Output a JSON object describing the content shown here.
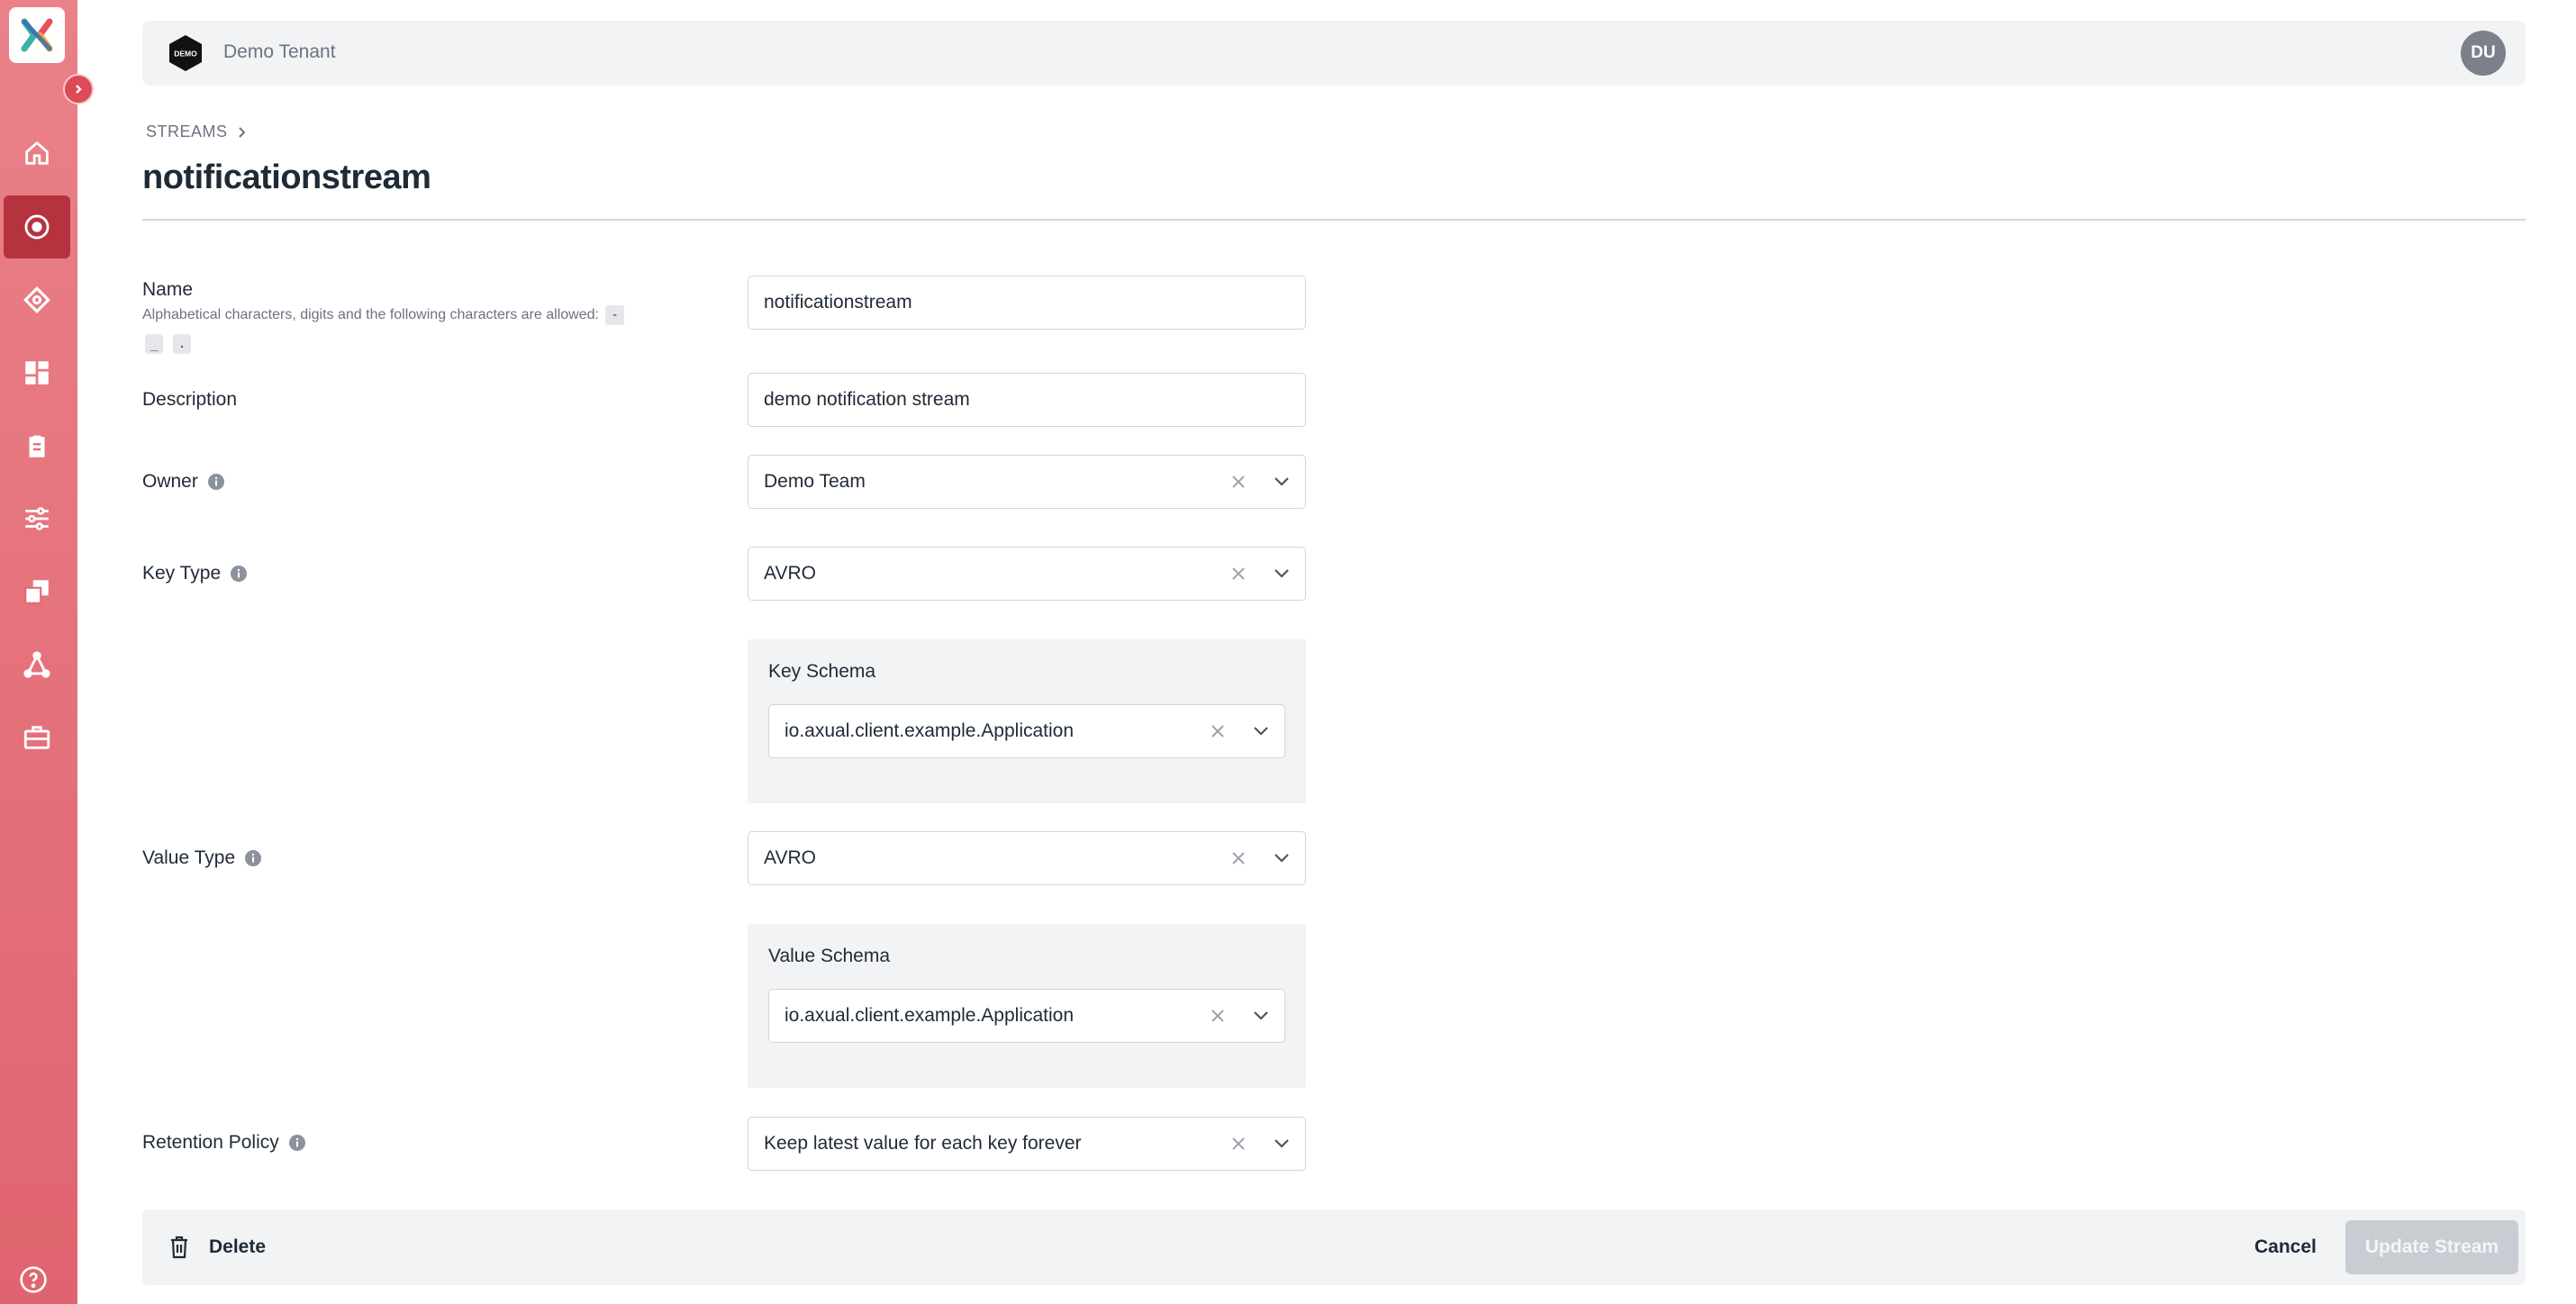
{
  "sidebar": {
    "logo_icon": "axual-x-logo",
    "items": [
      {
        "name": "home",
        "icon": "home-icon"
      },
      {
        "name": "streams",
        "icon": "stream-target-icon",
        "active": true
      },
      {
        "name": "applications",
        "icon": "diamond-icon"
      },
      {
        "name": "dashboards",
        "icon": "grid-icon"
      },
      {
        "name": "schemas",
        "icon": "clipboard-icon"
      },
      {
        "name": "settings",
        "icon": "sliders-icon"
      },
      {
        "name": "environments",
        "icon": "copy-icon"
      },
      {
        "name": "topology",
        "icon": "network-icon"
      },
      {
        "name": "services",
        "icon": "toolbox-icon"
      }
    ],
    "help_icon": "help-icon"
  },
  "topbar": {
    "tenant_logo_text": "DEMO",
    "tenant_name": "Demo Tenant",
    "avatar_initials": "DU"
  },
  "breadcrumb": {
    "items": [
      "STREAMS"
    ]
  },
  "page_title": "notificationstream",
  "form": {
    "name": {
      "label": "Name",
      "hint": "Alphabetical characters, digits and the following characters are allowed:",
      "chars": [
        "-",
        "_",
        "."
      ],
      "value": "notificationstream"
    },
    "description": {
      "label": "Description",
      "value": "demo notification stream"
    },
    "owner": {
      "label": "Owner",
      "value": "Demo Team"
    },
    "key_type": {
      "label": "Key Type",
      "value": "AVRO"
    },
    "key_schema": {
      "label": "Key Schema",
      "value": "io.axual.client.example.Application"
    },
    "value_type": {
      "label": "Value Type",
      "value": "AVRO"
    },
    "value_schema": {
      "label": "Value Schema",
      "value": "io.axual.client.example.Application"
    },
    "retention_policy": {
      "label": "Retention Policy",
      "value": "Keep latest value for each key forever"
    }
  },
  "footer": {
    "delete_label": "Delete",
    "cancel_label": "Cancel",
    "update_label": "Update Stream"
  },
  "colors": {
    "sidebar": "#e26a74",
    "sidebar_active": "#b7323f",
    "text": "#1f2a37",
    "muted": "#6b7280",
    "panel": "#f2f3f5",
    "disabled_button": "#c9cdd3"
  }
}
